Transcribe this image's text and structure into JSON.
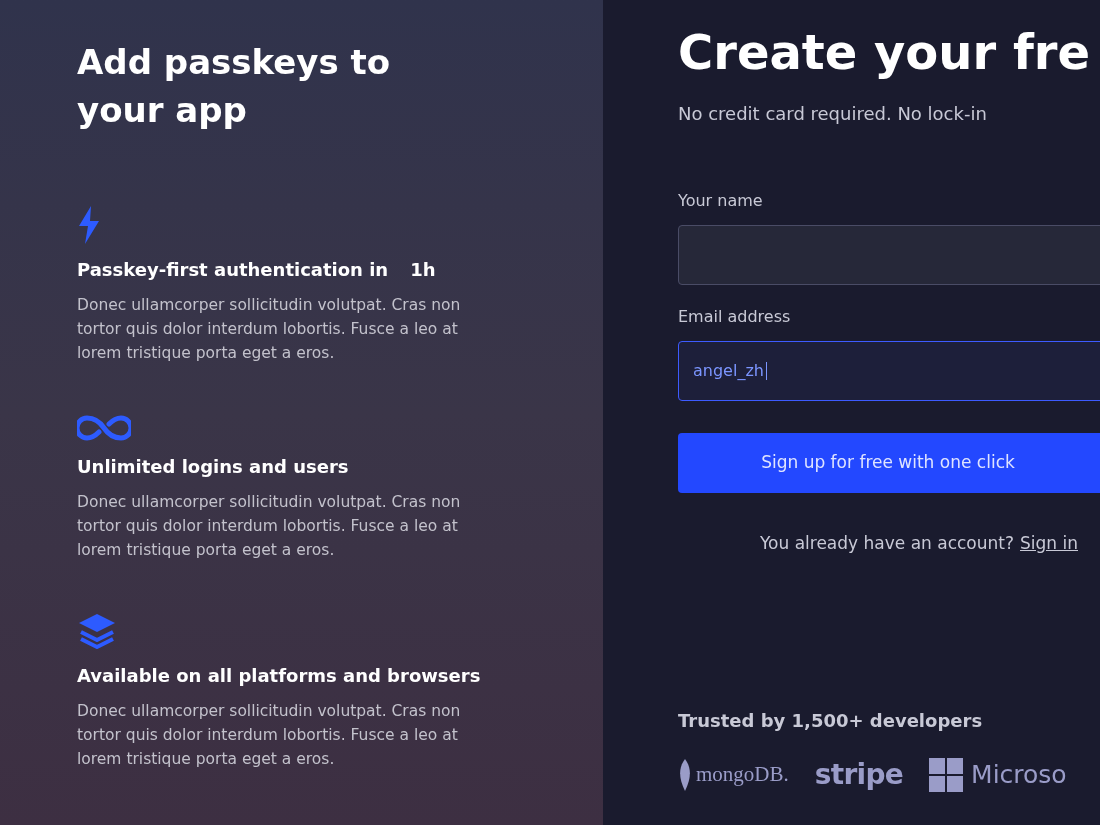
{
  "promo": {
    "heading": "Add passkeys to your app",
    "features": [
      {
        "kind": "bolt",
        "title": "Passkey-first authentication in",
        "highlight": "1h",
        "body": "Donec ullamcorper sollicitudin volutpat. Cras non tortor quis dolor interdum lobortis. Fusce a leo at lorem tristique porta eget a eros."
      },
      {
        "kind": "infinity",
        "title": "Unlimited logins and users",
        "body": "Donec ullamcorper sollicitudin volutpat. Cras non tortor quis dolor interdum lobortis. Fusce a leo at lorem tristique porta eget a eros."
      },
      {
        "kind": "layers",
        "title": "Available on all platforms and browsers",
        "body": "Donec ullamcorper sollicitudin volutpat. Cras non tortor quis dolor interdum lobortis. Fusce a leo at lorem tristique porta eget a eros."
      }
    ]
  },
  "signup": {
    "title": "Create your fre",
    "subtitle": "No credit card required. No lock-in",
    "fields": [
      {
        "label": "Your name",
        "focused": false
      },
      {
        "label": "Email address",
        "value": "angel_zh",
        "focused": true
      }
    ],
    "button": "Sign up for free with one click",
    "signin_prompt": "You already have an account?",
    "signin_link": "Sign in",
    "trusted": "Trusted by 1,500+ developers",
    "logos": [
      {
        "kind": "mongodb",
        "text": "mongoDB."
      },
      {
        "kind": "stripe",
        "text": "stripe"
      },
      {
        "kind": "microsoft",
        "text": "Microso"
      }
    ]
  }
}
